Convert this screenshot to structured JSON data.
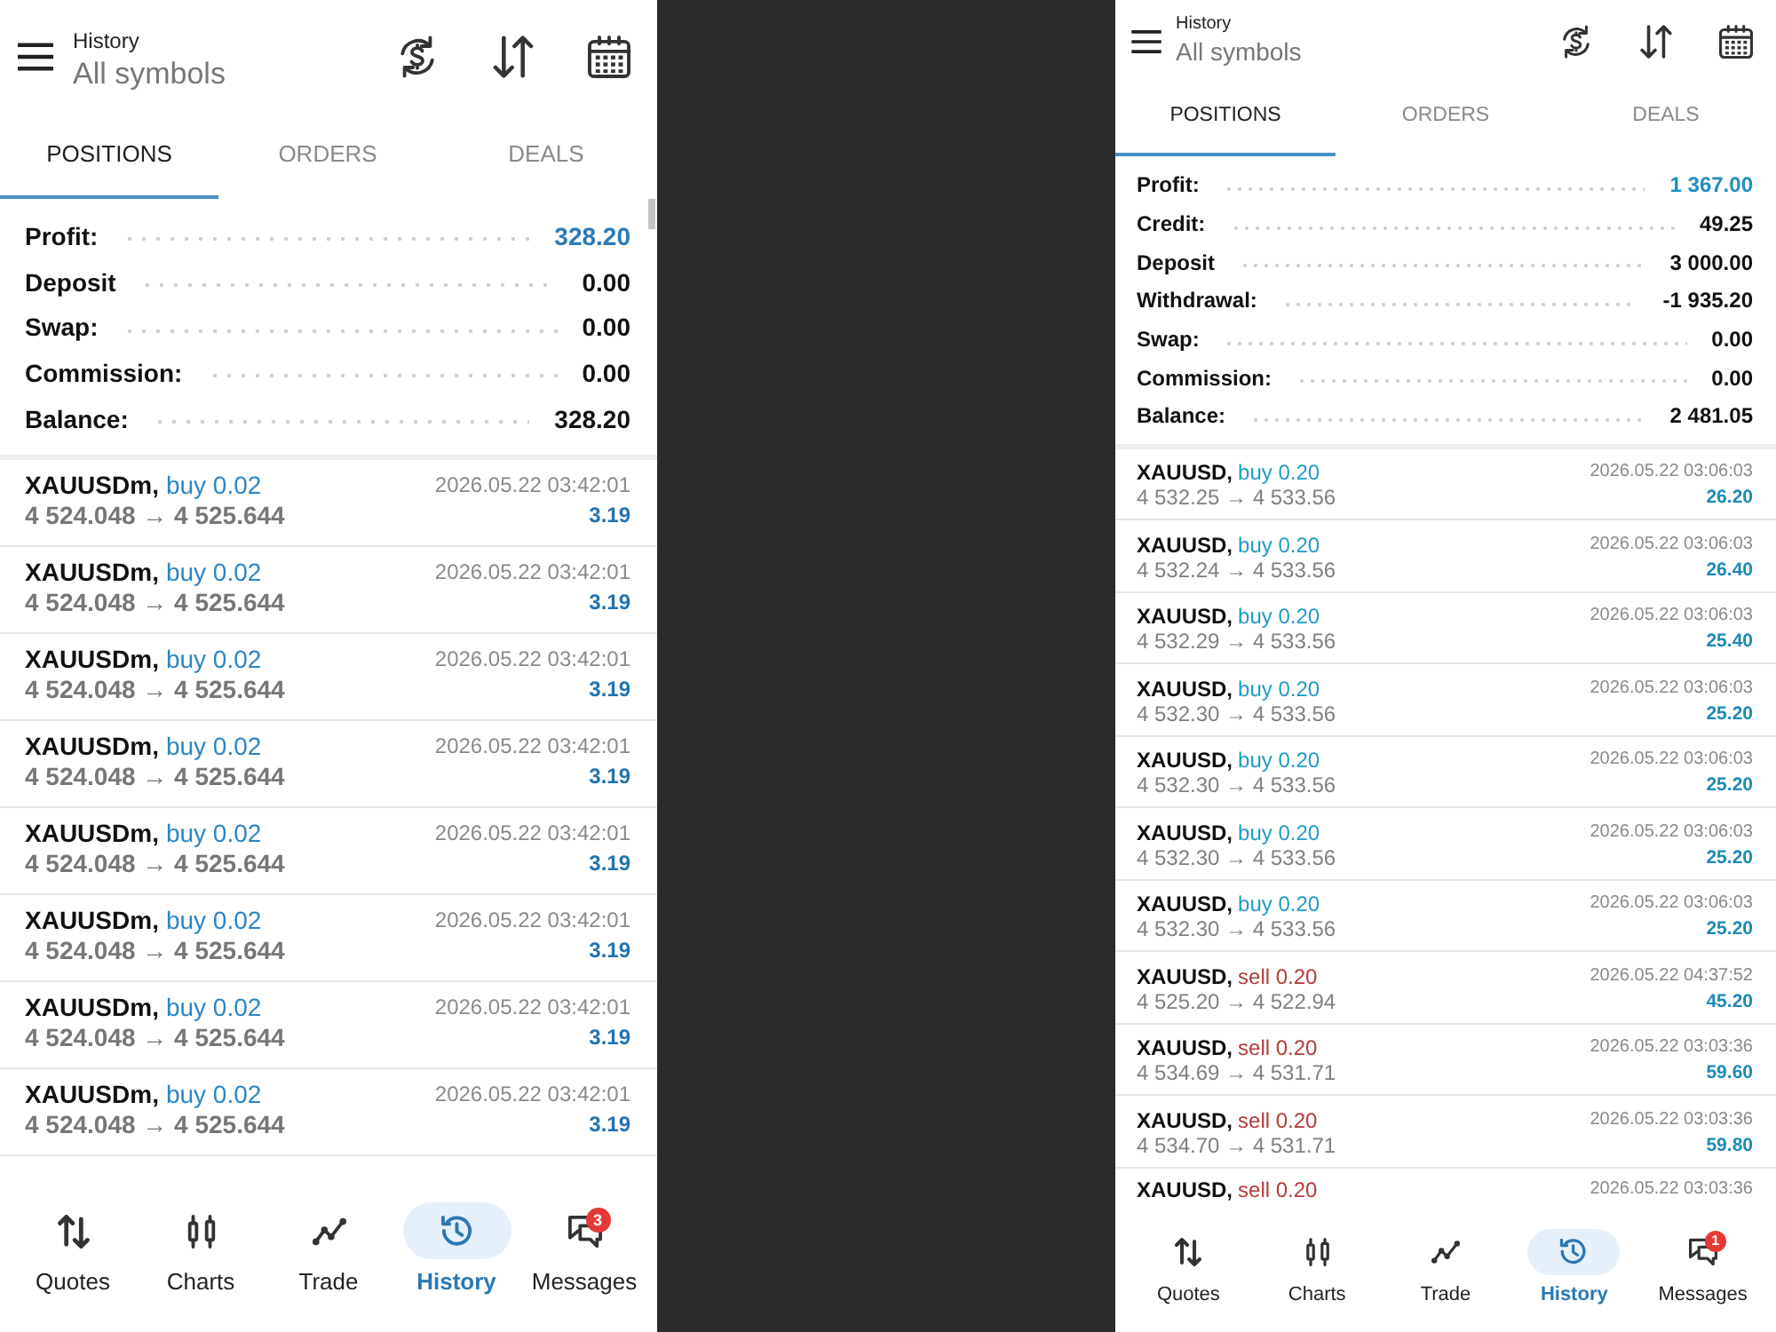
{
  "screens": [
    {
      "header": {
        "title": "History",
        "subtitle": "All symbols"
      },
      "tabs": [
        {
          "label": "POSITIONS",
          "selected": true
        },
        {
          "label": "ORDERS",
          "selected": false
        },
        {
          "label": "DEALS",
          "selected": false
        }
      ],
      "summary": [
        {
          "kind": "profit",
          "label": "Profit:",
          "value": "328.20"
        },
        {
          "kind": "amount",
          "label": "Deposit",
          "value": "0.00"
        },
        {
          "kind": "amount",
          "label": "Swap:",
          "value": "0.00"
        },
        {
          "kind": "amount",
          "label": "Commission:",
          "value": "0.00"
        },
        {
          "kind": "amount",
          "label": "Balance:",
          "value": "328.20"
        }
      ],
      "positions": [
        {
          "symbol": "XAUUSDm,",
          "kind": "buy",
          "trade": "buy 0.02",
          "time": "2026.05.22 03:42:01",
          "prices": "4 524.048 → 4 525.644",
          "profit": "3.19"
        },
        {
          "symbol": "XAUUSDm,",
          "kind": "buy",
          "trade": "buy 0.02",
          "time": "2026.05.22 03:42:01",
          "prices": "4 524.048 → 4 525.644",
          "profit": "3.19"
        },
        {
          "symbol": "XAUUSDm,",
          "kind": "buy",
          "trade": "buy 0.02",
          "time": "2026.05.22 03:42:01",
          "prices": "4 524.048 → 4 525.644",
          "profit": "3.19"
        },
        {
          "symbol": "XAUUSDm,",
          "kind": "buy",
          "trade": "buy 0.02",
          "time": "2026.05.22 03:42:01",
          "prices": "4 524.048 → 4 525.644",
          "profit": "3.19"
        },
        {
          "symbol": "XAUUSDm,",
          "kind": "buy",
          "trade": "buy 0.02",
          "time": "2026.05.22 03:42:01",
          "prices": "4 524.048 → 4 525.644",
          "profit": "3.19"
        },
        {
          "symbol": "XAUUSDm,",
          "kind": "buy",
          "trade": "buy 0.02",
          "time": "2026.05.22 03:42:01",
          "prices": "4 524.048 → 4 525.644",
          "profit": "3.19"
        },
        {
          "symbol": "XAUUSDm,",
          "kind": "buy",
          "trade": "buy 0.02",
          "time": "2026.05.22 03:42:01",
          "prices": "4 524.048 → 4 525.644",
          "profit": "3.19"
        },
        {
          "symbol": "XAUUSDm,",
          "kind": "buy",
          "trade": "buy 0.02",
          "time": "2026.05.22 03:42:01",
          "prices": "4 524.048 → 4 525.644",
          "profit": "3.19"
        }
      ],
      "nav": [
        {
          "label": "Quotes",
          "selected": false
        },
        {
          "label": "Charts",
          "selected": false
        },
        {
          "label": "Trade",
          "selected": false
        },
        {
          "label": "History",
          "selected": true
        },
        {
          "label": "Messages",
          "selected": false,
          "badge": "3"
        }
      ]
    },
    {
      "header": {
        "title": "History",
        "subtitle": "All symbols"
      },
      "tabs": [
        {
          "label": "POSITIONS",
          "selected": true
        },
        {
          "label": "ORDERS",
          "selected": false
        },
        {
          "label": "DEALS",
          "selected": false
        }
      ],
      "summary": [
        {
          "kind": "profit",
          "label": "Profit:",
          "value": "1 367.00"
        },
        {
          "kind": "amount",
          "label": "Credit:",
          "value": "49.25"
        },
        {
          "kind": "amount",
          "label": "Deposit",
          "value": "3 000.00"
        },
        {
          "kind": "amount",
          "label": "Withdrawal:",
          "value": "-1 935.20"
        },
        {
          "kind": "amount",
          "label": "Swap:",
          "value": "0.00"
        },
        {
          "kind": "amount",
          "label": "Commission:",
          "value": "0.00"
        },
        {
          "kind": "amount",
          "label": "Balance:",
          "value": "2 481.05"
        }
      ],
      "positions": [
        {
          "symbol": "XAUUSD,",
          "kind": "buy",
          "trade": "buy 0.20",
          "time": "2026.05.22 03:06:03",
          "prices": "4 532.25 → 4 533.56",
          "profit": "26.20"
        },
        {
          "symbol": "XAUUSD,",
          "kind": "buy",
          "trade": "buy 0.20",
          "time": "2026.05.22 03:06:03",
          "prices": "4 532.24 → 4 533.56",
          "profit": "26.40"
        },
        {
          "symbol": "XAUUSD,",
          "kind": "buy",
          "trade": "buy 0.20",
          "time": "2026.05.22 03:06:03",
          "prices": "4 532.29 → 4 533.56",
          "profit": "25.40"
        },
        {
          "symbol": "XAUUSD,",
          "kind": "buy",
          "trade": "buy 0.20",
          "time": "2026.05.22 03:06:03",
          "prices": "4 532.30 → 4 533.56",
          "profit": "25.20"
        },
        {
          "symbol": "XAUUSD,",
          "kind": "buy",
          "trade": "buy 0.20",
          "time": "2026.05.22 03:06:03",
          "prices": "4 532.30 → 4 533.56",
          "profit": "25.20"
        },
        {
          "symbol": "XAUUSD,",
          "kind": "buy",
          "trade": "buy 0.20",
          "time": "2026.05.22 03:06:03",
          "prices": "4 532.30 → 4 533.56",
          "profit": "25.20"
        },
        {
          "symbol": "XAUUSD,",
          "kind": "buy",
          "trade": "buy 0.20",
          "time": "2026.05.22 03:06:03",
          "prices": "4 532.30 → 4 533.56",
          "profit": "25.20"
        },
        {
          "symbol": "XAUUSD,",
          "kind": "sell",
          "trade": "sell 0.20",
          "time": "2026.05.22 04:37:52",
          "prices": "4 525.20 → 4 522.94",
          "profit": "45.20"
        },
        {
          "symbol": "XAUUSD,",
          "kind": "sell",
          "trade": "sell 0.20",
          "time": "2026.05.22 03:03:36",
          "prices": "4 534.69 → 4 531.71",
          "profit": "59.60"
        },
        {
          "symbol": "XAUUSD,",
          "kind": "sell",
          "trade": "sell 0.20",
          "time": "2026.05.22 03:03:36",
          "prices": "4 534.70 → 4 531.71",
          "profit": "59.80"
        },
        {
          "symbol": "XAUUSD,",
          "kind": "sell",
          "trade": "sell 0.20",
          "time": "2026.05.22 03:03:36"
        }
      ],
      "nav": [
        {
          "label": "Quotes",
          "selected": false
        },
        {
          "label": "Charts",
          "selected": false
        },
        {
          "label": "Trade",
          "selected": false
        },
        {
          "label": "History",
          "selected": true
        },
        {
          "label": "Messages",
          "selected": false,
          "badge": "1"
        }
      ]
    }
  ]
}
